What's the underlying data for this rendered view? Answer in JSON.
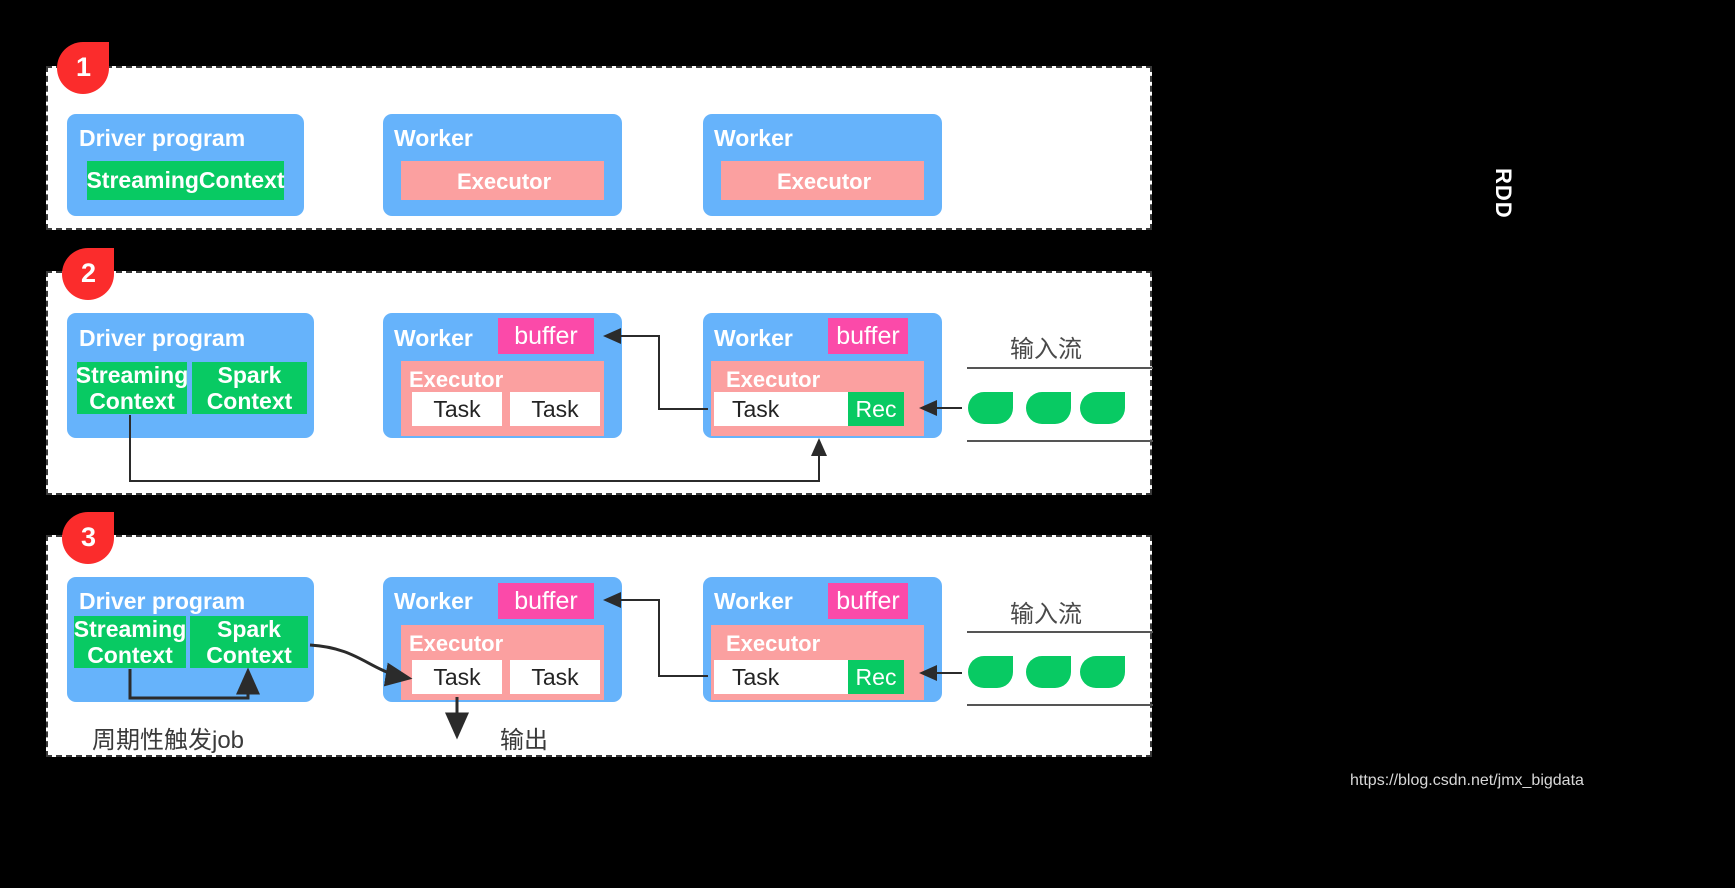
{
  "meta": {
    "rdd_label": "RDD",
    "watermark": "https://blog.csdn.net/jmx_bigdata"
  },
  "labels": {
    "driver_program": "Driver program",
    "worker": "Worker",
    "executor": "Executor",
    "streaming_context": "StreamingContext",
    "streaming": "Streaming\nContext",
    "streaming_line1": "Streaming",
    "streaming_line2": "Context",
    "spark_line1": "Spark",
    "spark_line2": "Context",
    "task": "Task",
    "rec": "Rec",
    "buffer": "buffer",
    "input_stream": "输入流",
    "periodic_job": "周期性触发job",
    "output": "输出"
  },
  "panels": [
    {
      "number": "1"
    },
    {
      "number": "2"
    },
    {
      "number": "3"
    }
  ],
  "colors": {
    "panel_bg": "#ffffff",
    "panel_border": "#3a3a3a",
    "badge": "#fb2c2c",
    "blue": "#66b3fb",
    "green": "#08ca63",
    "salmon": "#fba0a0",
    "pink": "#fb4aa9",
    "task_bg": "#ffffff",
    "background": "#000000"
  },
  "panel1": {
    "driver": {
      "title": "Driver program",
      "inner": "StreamingContext"
    },
    "workers": [
      {
        "title": "Worker",
        "executor": "Executor"
      },
      {
        "title": "Worker",
        "executor": "Executor"
      }
    ]
  },
  "panel2": {
    "driver": {
      "title": "Driver program",
      "contexts": [
        {
          "line1": "Streaming",
          "line2": "Context"
        },
        {
          "line1": "Spark",
          "line2": "Context"
        }
      ]
    },
    "worker_left": {
      "title": "Worker",
      "buffer": "buffer",
      "executor": "Executor",
      "tasks": [
        "Task",
        "Task"
      ]
    },
    "worker_right": {
      "title": "Worker",
      "buffer": "buffer",
      "executor": "Executor",
      "tasks": [
        "Task"
      ],
      "rec": "Rec"
    },
    "stream": {
      "label": "输入流",
      "leaves": 3
    }
  },
  "panel3": {
    "driver": {
      "title": "Driver program",
      "contexts": [
        {
          "line1": "Streaming",
          "line2": "Context"
        },
        {
          "line1": "Spark",
          "line2": "Context"
        }
      ]
    },
    "worker_left": {
      "title": "Worker",
      "buffer": "buffer",
      "executor": "Executor",
      "tasks": [
        "Task",
        "Task"
      ]
    },
    "worker_right": {
      "title": "Worker",
      "buffer": "buffer",
      "executor": "Executor",
      "tasks": [
        "Task"
      ],
      "rec": "Rec"
    },
    "stream": {
      "label": "输入流",
      "leaves": 3
    },
    "footer": {
      "periodic": "周期性触发job",
      "output": "输出"
    }
  }
}
